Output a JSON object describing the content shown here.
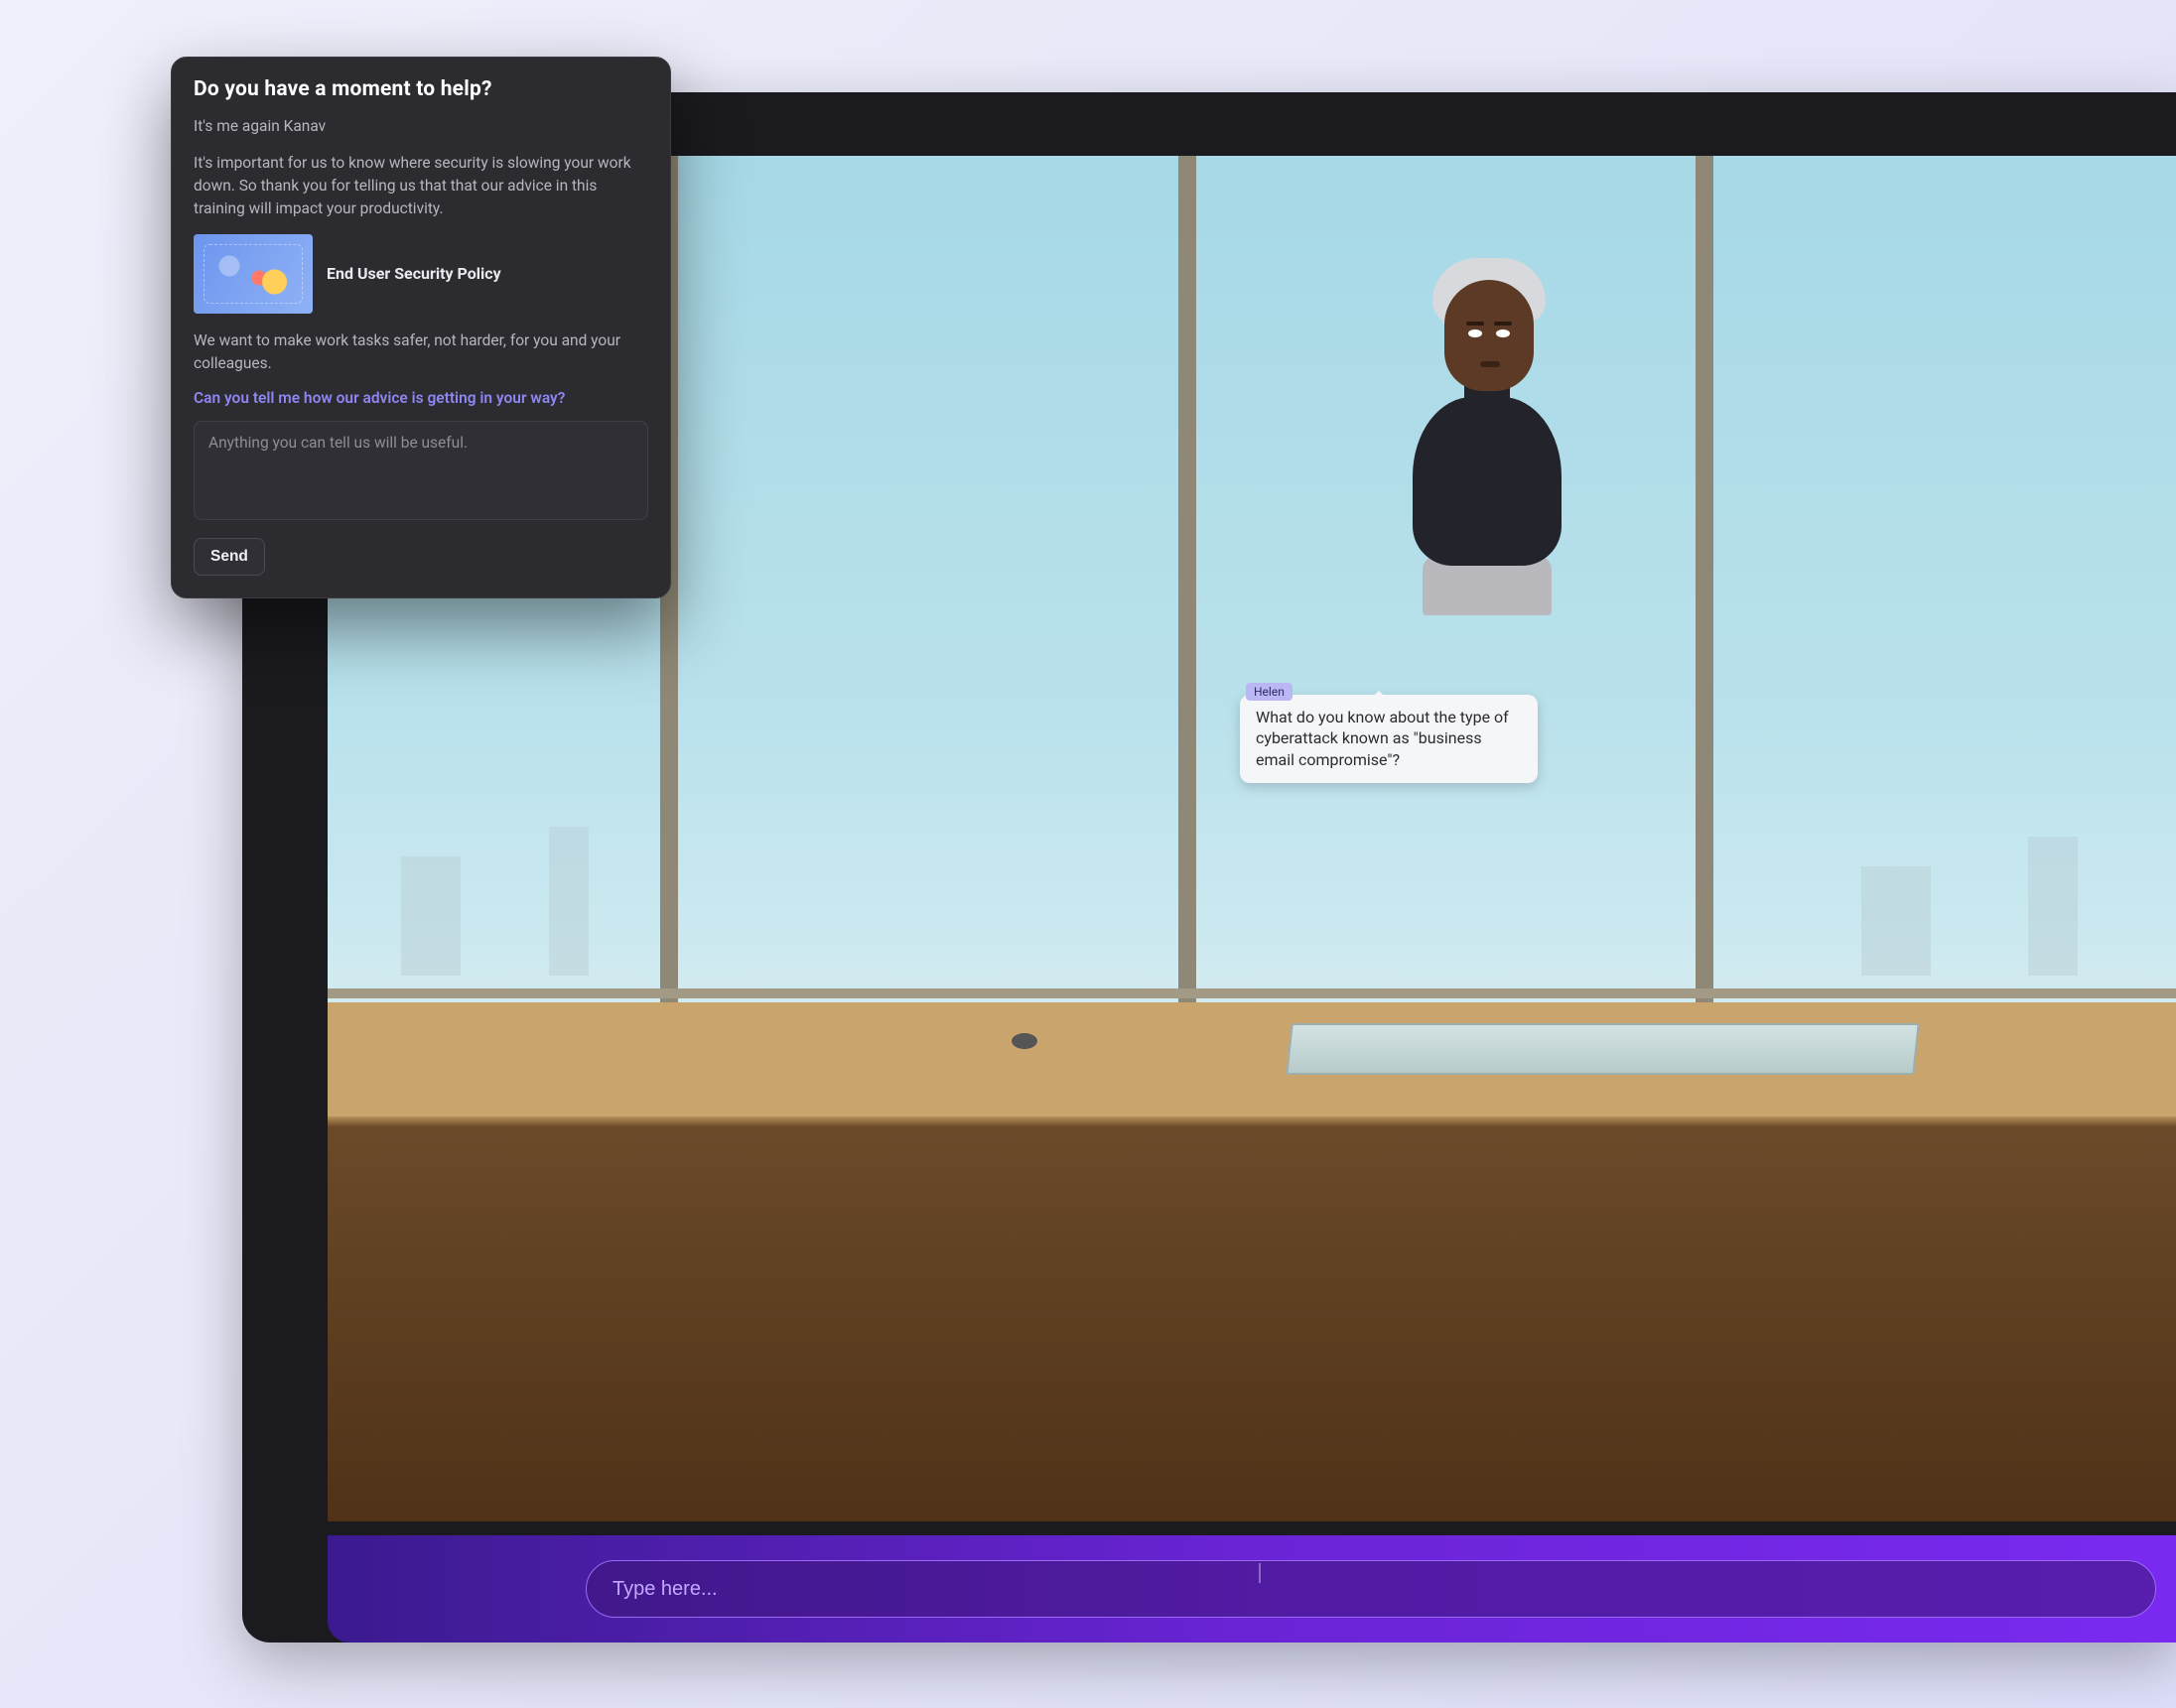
{
  "dialog": {
    "title": "Do you have a moment to help?",
    "greeting": "It's me again Kanav",
    "intro": "It's important for us to know where security is slowing your work down. So thank you for telling us that that our advice in this training will impact your productivity.",
    "policy_title": "End User Security Policy",
    "followup": "We want to make work tasks safer, not harder, for you and your colleagues.",
    "question": "Can you tell me how our advice is getting in your way?",
    "textarea_placeholder": "Anything you can tell us will be useful.",
    "textarea_value": "",
    "send_label": "Send"
  },
  "game": {
    "speaker_name": "Helen",
    "speech": "What do you know about the type of cyberattack known as \"business email compromise\"?",
    "input_placeholder": "Type here...",
    "input_value": ""
  },
  "colors": {
    "accent_purple": "#7a2af0",
    "link_violet": "#8e86f0",
    "dialog_bg": "#2b2b30"
  }
}
